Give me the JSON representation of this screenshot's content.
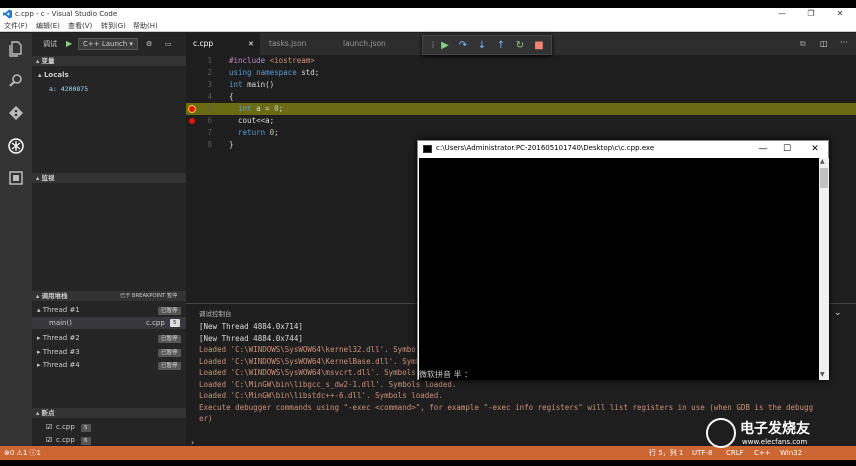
{
  "window": {
    "title": "c.cpp - c - Visual Studio Code",
    "minimize": "—",
    "restore": "❐",
    "close": "✕"
  },
  "menu": [
    "文件(F)",
    "编辑(E)",
    "查看(V)",
    "转到(G)",
    "帮助(H)"
  ],
  "activity": {
    "explorer": "explorer-icon",
    "search": "search-icon",
    "git": "git-icon",
    "debug": "debug-icon",
    "extensions": "extensions-icon"
  },
  "debug_bar": {
    "label": "调试",
    "config": "C++ Launch ▾"
  },
  "sidebar": {
    "variables_title": "▴ 变量",
    "locals_label": "▴ Locals",
    "local_var": "a: 4200875",
    "watch_title": "▴ 监视",
    "callstack_title": "▴ 调用堆栈",
    "callstack_hint": "已于 BREAKPOINT 暂停",
    "threads": [
      {
        "name": "▴ Thread #1",
        "state": "已暂停"
      },
      {
        "name": "main()",
        "file": "c.cpp",
        "line": "5"
      },
      {
        "name": "▸ Thread #2",
        "state": "已暂停"
      },
      {
        "name": "▸ Thread #3",
        "state": "已暂停"
      },
      {
        "name": "▸ Thread #4",
        "state": "已暂停"
      }
    ],
    "breakpoints_title": "▴ 断点",
    "breakpoints": [
      {
        "file": "c.cpp",
        "line": "5"
      },
      {
        "file": "c.cpp",
        "line": "6"
      }
    ]
  },
  "tabs": [
    {
      "label": "c.cpp",
      "close": "✕"
    },
    {
      "label": "tasks.json"
    },
    {
      "label": "launch.json"
    }
  ],
  "code": [
    {
      "n": "1",
      "parts": [
        [
          "pp",
          "#include "
        ],
        [
          "st",
          "<iostream>"
        ]
      ]
    },
    {
      "n": "2",
      "parts": [
        [
          "kw",
          "using namespace "
        ],
        [
          "id",
          "std;"
        ]
      ]
    },
    {
      "n": "3",
      "parts": [
        [
          "kw",
          "int "
        ],
        [
          "id",
          "main()"
        ]
      ]
    },
    {
      "n": "4",
      "parts": [
        [
          "id",
          "{"
        ]
      ]
    },
    {
      "n": "5",
      "parts": [
        [
          "id",
          "  "
        ],
        [
          "kw",
          "int "
        ],
        [
          "id",
          "a = "
        ],
        [
          "nm",
          "0"
        ],
        [
          "id",
          ";"
        ]
      ]
    },
    {
      "n": "6",
      "parts": [
        [
          "id",
          "  cout<<a;"
        ]
      ]
    },
    {
      "n": "7",
      "parts": [
        [
          "id",
          "  "
        ],
        [
          "kw",
          "return "
        ],
        [
          "nm",
          "0"
        ],
        [
          "id",
          ";"
        ]
      ]
    },
    {
      "n": "8",
      "parts": [
        [
          "id",
          "}"
        ]
      ]
    }
  ],
  "panel": {
    "title": "调试控制台",
    "lines": [
      "[New Thread 4884.0x714]",
      "[New Thread 4884.0x744]",
      "Loaded 'C:\\WINDOWS\\SysWOW64\\kernel32.dll'. Symbols loaded.",
      "Loaded 'C:\\WINDOWS\\SysWOW64\\KernelBase.dll'. Symbols loaded.",
      "Loaded 'C:\\WINDOWS\\SysWOW64\\msvcrt.dll'. Symbols loaded.",
      "Loaded 'C:\\MinGW\\bin\\libgcc_s_dw2-1.dll'. Symbols loaded.",
      "Loaded 'C:\\MinGW\\bin\\libstdc++-6.dll'. Symbols loaded.",
      "Execute debugger commands using \"-exec <command>\", for example \"-exec info registers\" will list registers in use (when GDB is the debugg",
      "er)"
    ],
    "prompt": "›"
  },
  "console_window": {
    "title": "c:\\Users\\Administrator.PC-201605101740\\Desktop\\c\\c.cpp.exe",
    "ime": "微软拼音 半 ："
  },
  "status": {
    "left": "⊗0 ⚠1 ⓘ1",
    "position": "行 5，列 1",
    "encoding": "UTF-8",
    "eol": "CRLF",
    "lang": "C++",
    "platform": "Win32"
  },
  "watermark": {
    "brand": "电子发烧友",
    "url": "www.elecfans.com"
  },
  "colors": {
    "status_bg": "#cc6633",
    "line_highlight": "#6b6b14",
    "breakpoint": "#e51400"
  }
}
